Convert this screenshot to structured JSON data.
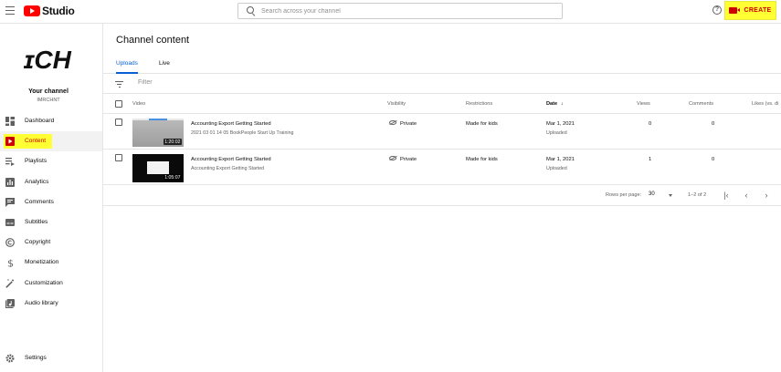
{
  "app": {
    "logo_text": "Studio"
  },
  "header": {
    "search_placeholder": "Search across your channel",
    "help_glyph": "?",
    "create_label": "CREATE"
  },
  "sidebar": {
    "avatar_text": "ɪCH",
    "channel_label": "Your channel",
    "channel_name": "IMRCHNT",
    "items": [
      {
        "label": "Dashboard"
      },
      {
        "label": "Content"
      },
      {
        "label": "Playlists"
      },
      {
        "label": "Analytics"
      },
      {
        "label": "Comments"
      },
      {
        "label": "Subtitles"
      },
      {
        "label": "Copyright"
      },
      {
        "label": "Monetization"
      },
      {
        "label": "Customization"
      },
      {
        "label": "Audio library"
      }
    ],
    "settings_label": "Settings"
  },
  "main": {
    "title": "Channel content",
    "tabs": [
      {
        "label": "Uploads"
      },
      {
        "label": "Live"
      }
    ],
    "filter_placeholder": "Filter",
    "columns": {
      "video": "Video",
      "visibility": "Visibility",
      "restrictions": "Restrictions",
      "date": "Date",
      "date_sort_glyph": "↓",
      "views": "Views",
      "comments": "Comments",
      "likes": "Likes (vs. di"
    },
    "rows": [
      {
        "duration": "1:20:02",
        "title": "Accounting Export Getting Started",
        "description": "2021 03 01 14 05 BookPeople Start Up Training",
        "visibility": "Private",
        "restrictions": "Made for kids",
        "date": "Mar 1, 2021",
        "date_status": "Uploaded",
        "views": "0",
        "comments": "0"
      },
      {
        "duration": "1:05:07",
        "title": "Accounting Export Getting Started",
        "description": "Accounting Export Getting Started",
        "visibility": "Private",
        "restrictions": "Made for kids",
        "date": "Mar 1, 2021",
        "date_status": "Uploaded",
        "views": "1",
        "comments": "0"
      }
    ],
    "pagination": {
      "rows_per_page_label": "Rows per page:",
      "rows_per_page_value": "30",
      "range_text": "1–2 of 2",
      "first_glyph": "|‹",
      "prev_glyph": "‹",
      "next_glyph": "›"
    }
  },
  "colors": {
    "brand_red": "#ff0000",
    "highlight_yellow": "#ffff33",
    "tab_blue": "#065fd4"
  }
}
